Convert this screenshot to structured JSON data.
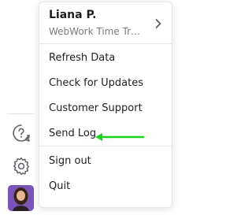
{
  "sidebar": {
    "icons": [
      "help-chat-icon",
      "gear-icon"
    ]
  },
  "user": {
    "name": "Liana P.",
    "subtitle": "WebWork Time Tracker"
  },
  "menu": {
    "items": [
      {
        "label": "Refresh Data"
      },
      {
        "label": "Check for Updates"
      },
      {
        "label": "Customer Support"
      },
      {
        "label": "Send Log"
      },
      {
        "label": "Sign out"
      },
      {
        "label": "Quit"
      }
    ]
  },
  "colors": {
    "annotation_arrow": "#19d11f",
    "avatar_bg": "#7a55b8"
  }
}
